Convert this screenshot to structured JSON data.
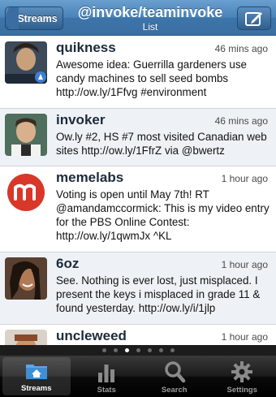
{
  "navbar": {
    "back_label": "Streams",
    "title": "@invoke/teaminvoke",
    "subtitle": "List",
    "compose_icon": "compose-icon"
  },
  "tweets": [
    {
      "user": "quikness",
      "time": "46 mins ago",
      "text": "Awesome idea: Guerrilla gardeners use candy machines to sell seed bombs http://ow.ly/1Ffvg #environment"
    },
    {
      "user": "invoker",
      "time": "46 mins ago",
      "text": "Ow.ly #2, HS #7 most visited Canadian web sites http://ow.ly/1FfrZ via @bwertz"
    },
    {
      "user": "memelabs",
      "time": "1 hour ago",
      "text": "Voting is open until May 7th!  RT @amandamccormick: This is my video entry for the PBS Online Contest: http://ow.ly/1qwmJx ^KL"
    },
    {
      "user": "6oz",
      "time": "1 hour ago",
      "text": "See. Nothing is ever lost, just misplaced. I present the keys i misplaced in grade 11 & found yesterday. http://ow.ly/i/1jlp"
    },
    {
      "user": "uncleweed",
      "time": "1 hour ago",
      "text": ""
    }
  ],
  "pager": {
    "pages": 7,
    "current": 3
  },
  "tabs": [
    {
      "label": "Streams",
      "icon": "home-folder-icon",
      "selected": true
    },
    {
      "label": "Stats",
      "icon": "bar-chart-icon",
      "selected": false
    },
    {
      "label": "Search",
      "icon": "magnifier-icon",
      "selected": false
    },
    {
      "label": "Settings",
      "icon": "gear-icon",
      "selected": false
    }
  ],
  "colors": {
    "navbar": "#4a83b9",
    "alt_row": "#eef2f6",
    "tabbar": "#1a1a1a",
    "selected_tab_icon": "#5aa7e6"
  }
}
